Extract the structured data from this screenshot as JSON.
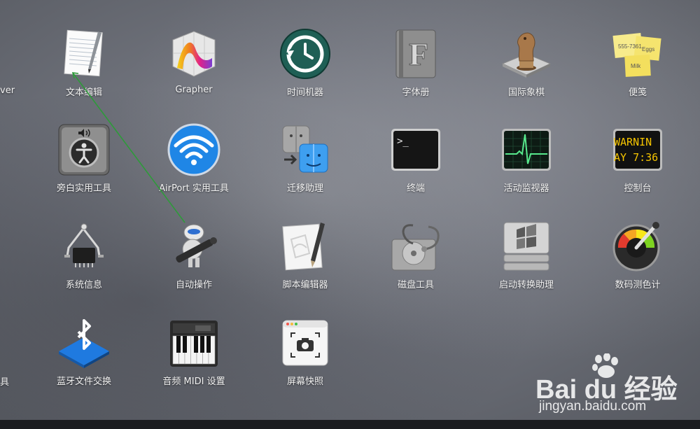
{
  "edge_labels": {
    "left_row1": "ver",
    "left_row4": "具"
  },
  "apps": {
    "textedit": "文本编辑",
    "grapher": "Grapher",
    "timemachine": "时间机器",
    "fontbook": "字体册",
    "chess": "国际象棋",
    "stickies": "便笺",
    "voiceover": "旁白实用工具",
    "airport": "AirPort 实用工具",
    "migration": "迁移助理",
    "terminal": "终端",
    "activity": "活动监视器",
    "console": "控制台",
    "sysinfo": "系统信息",
    "automator": "自动操作",
    "scripteditor": "脚本编辑器",
    "diskutility": "磁盘工具",
    "bootcamp": "启动转换助理",
    "colormeter": "数码测色计",
    "bluetooth": "蓝牙文件交换",
    "audiomidi": "音频 MIDI 设置",
    "screenshot": "屏幕快照"
  },
  "icon_text": {
    "terminal_prompt": ">_",
    "console_line1": "WARNIN",
    "console_line2": "AY 7:36",
    "fontbook_letter": "F",
    "stickies_note1": "555-7361",
    "stickies_note2": "Eggs",
    "stickies_note3": "Milk"
  },
  "watermark": {
    "brand": "Bai du 经验",
    "url": "jingyan.baidu.com"
  },
  "colors": {
    "annotation_arrow": "#2e9a3a",
    "label": "#f2f2f2"
  }
}
